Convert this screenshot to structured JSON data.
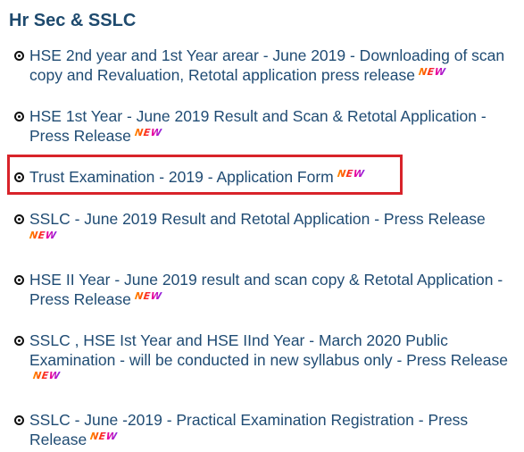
{
  "section": {
    "title": "Hr Sec & SSLC"
  },
  "colors": {
    "title": "#1e4a6e",
    "link": "#1f4b73",
    "highlight_border": "#d8232a",
    "new_badge_gradient": [
      "#ff8c00",
      "#ff3d00",
      "#e600a8",
      "#8a2be2"
    ]
  },
  "icons": {
    "bullet": "radio-dot-icon"
  },
  "news_badge": "NEW",
  "items": [
    {
      "text": "HSE 2nd year and 1st Year arear - June 2019 - Downloading of scan copy and Revaluation, Retotal application press release",
      "new": true,
      "highlighted": false
    },
    {
      "text": "HSE 1st Year - June 2019 Result and Scan & Retotal Application - Press Release",
      "new": true,
      "highlighted": false
    },
    {
      "text": "Trust Examination - 2019 - Application Form",
      "new": true,
      "highlighted": true
    },
    {
      "text": "SSLC - June 2019 Result and Retotal Application - Press Release",
      "new": true,
      "highlighted": false
    },
    {
      "text": "HSE II Year - June 2019 result and scan copy & Retotal Application - Press Release",
      "new": true,
      "highlighted": false
    },
    {
      "text": "SSLC , HSE Ist Year and HSE IInd Year - March 2020 Public Examination - will be conducted in new syllabus only - Press Release",
      "new": true,
      "highlighted": false
    },
    {
      "text": "SSLC - June -2019 - Practical Examination Registration - Press Release",
      "new": true,
      "highlighted": false
    }
  ]
}
